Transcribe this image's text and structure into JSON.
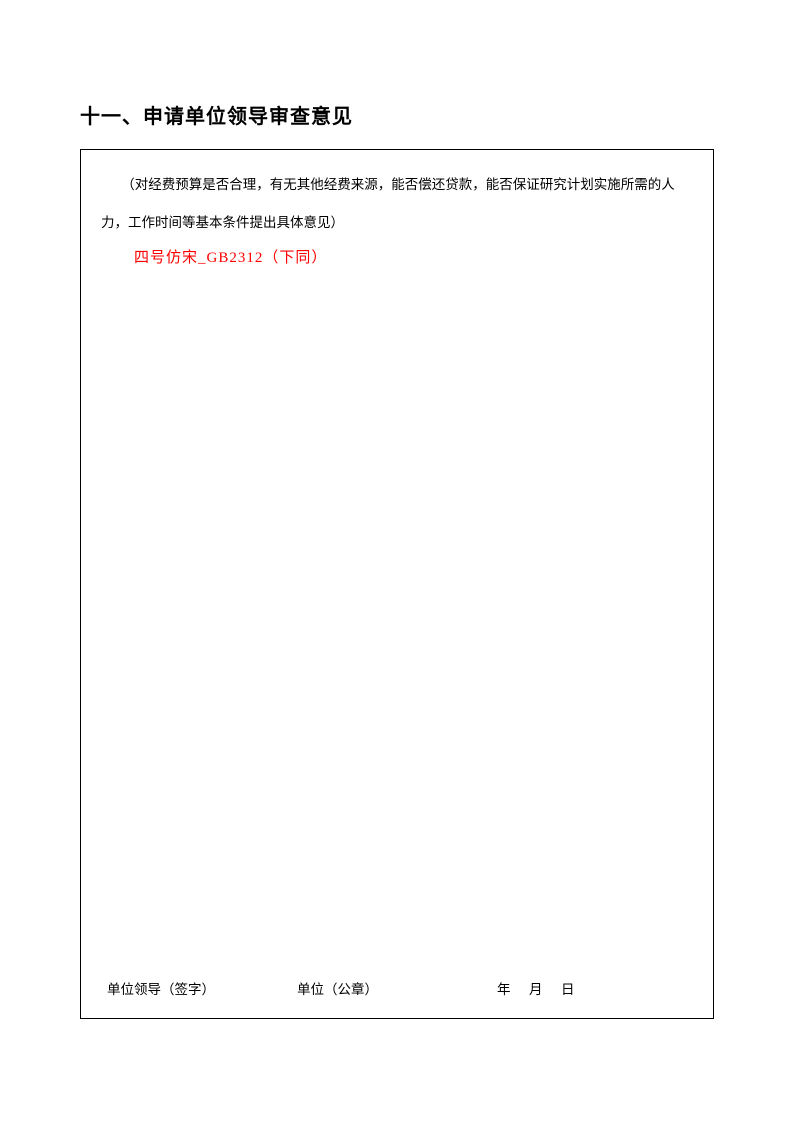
{
  "heading": "十一、申请单位领导审查意见",
  "instruction": "（对经费预算是否合理，有无其他经费来源，能否偿还贷款，能否保证研究计划实施所需的人力，工作时间等基本条件提出具体意见）",
  "annotation": "四号仿宋_GB2312（下同）",
  "signature": {
    "leader": "单位领导（签字）",
    "unit": "单位（公章）",
    "year": "年",
    "month": "月",
    "day": "日"
  }
}
